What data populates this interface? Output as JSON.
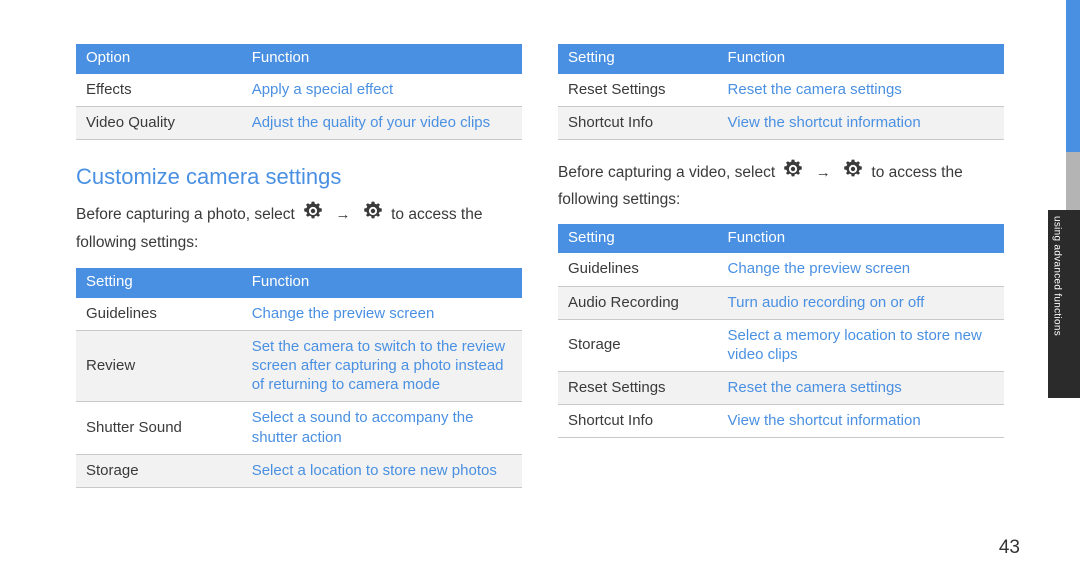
{
  "page": {
    "number": "43",
    "edge_tab_label": "using advanced functions",
    "accent_color": "#4a90e2",
    "link_color": "#4a90e2",
    "text_color": "#3a3a3a"
  },
  "left_column": {
    "table_top": {
      "headers": [
        "Option",
        "Function"
      ],
      "rows": [
        [
          "Effects",
          "Apply a special effect"
        ],
        [
          "Video Quality",
          "Adjust the quality of your video clips"
        ]
      ]
    },
    "heading": "Customize camera settings",
    "intro_before": "Before capturing a photo, select",
    "intro_arrow": "→",
    "intro_after": "to access the following settings:",
    "table_settings": {
      "headers": [
        "Setting",
        "Function"
      ],
      "rows": [
        [
          "Guidelines",
          "Change the preview screen"
        ],
        [
          "Review",
          "Set the camera to switch to the review screen after capturing a photo instead of returning to camera mode"
        ],
        [
          "Shutter Sound",
          "Select a sound to accompany the shutter action"
        ],
        [
          "Storage",
          "Select a location to store new photos"
        ]
      ]
    }
  },
  "right_column": {
    "table_top": {
      "headers": [
        "Setting",
        "Function"
      ],
      "rows": [
        [
          "Reset Settings",
          "Reset the camera settings"
        ],
        [
          "Shortcut Info",
          "View the shortcut information"
        ]
      ]
    },
    "intro_before": "Before capturing a video, select",
    "intro_arrow": "→",
    "intro_after": "to access the following settings:",
    "table_settings": {
      "headers": [
        "Setting",
        "Function"
      ],
      "rows": [
        [
          "Guidelines",
          "Change the preview screen"
        ],
        [
          "Audio Recording",
          "Turn audio recording on or off"
        ],
        [
          "Storage",
          "Select a memory location to store new video clips"
        ],
        [
          "Reset Settings",
          "Reset the camera settings"
        ],
        [
          "Shortcut Info",
          "View the shortcut information"
        ]
      ]
    }
  },
  "icons": {
    "gear": "gear-icon",
    "arrow": "arrow-right-icon"
  }
}
